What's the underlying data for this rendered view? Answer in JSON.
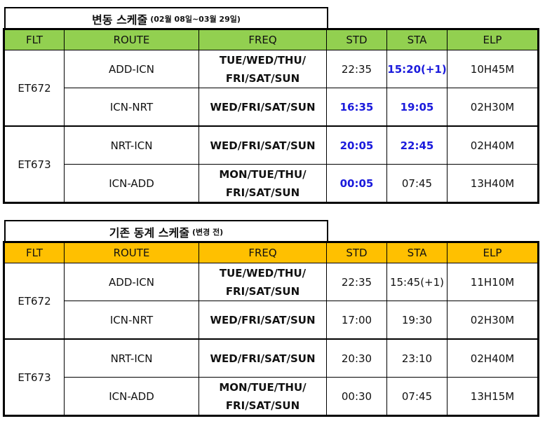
{
  "sections": [
    {
      "title": "변동 스케줄",
      "subtitle": "(02월 08일~03월 29일)",
      "header_color": "#92d050",
      "headers": [
        "FLT",
        "ROUTE",
        "FREQ",
        "STD",
        "STA",
        "ELP"
      ],
      "flights": [
        {
          "flt": "ET672",
          "rows": [
            {
              "route": "ADD-ICN",
              "freq": "TUE/WED/THU/\nFRI/SAT/SUN",
              "std": "22:35",
              "sta": "15:20(+1)",
              "elp": "10H45M",
              "std_changed": false,
              "sta_changed": true
            },
            {
              "route": "ICN-NRT",
              "freq": "WED/FRI/SAT/SUN",
              "std": "16:35",
              "sta": "19:05",
              "elp": "02H30M",
              "std_changed": true,
              "sta_changed": true
            }
          ]
        },
        {
          "flt": "ET673",
          "rows": [
            {
              "route": "NRT-ICN",
              "freq": "WED/FRI/SAT/SUN",
              "std": "20:05",
              "sta": "22:45",
              "elp": "02H40M",
              "std_changed": true,
              "sta_changed": true
            },
            {
              "route": "ICN-ADD",
              "freq": "MON/TUE/THU/\nFRI/SAT/SUN",
              "std": "00:05",
              "sta": "07:45",
              "elp": "13H40M",
              "std_changed": true,
              "sta_changed": false
            }
          ]
        }
      ]
    },
    {
      "title": "기존 동계 스케줄",
      "subtitle": "(변경 전)",
      "header_color": "#ffc000",
      "headers": [
        "FLT",
        "ROUTE",
        "FREQ",
        "STD",
        "STA",
        "ELP"
      ],
      "flights": [
        {
          "flt": "ET672",
          "rows": [
            {
              "route": "ADD-ICN",
              "freq": "TUE/WED/THU/\nFRI/SAT/SUN",
              "std": "22:35",
              "sta": "15:45(+1)",
              "elp": "11H10M",
              "std_changed": false,
              "sta_changed": false
            },
            {
              "route": "ICN-NRT",
              "freq": "WED/FRI/SAT/SUN",
              "std": "17:00",
              "sta": "19:30",
              "elp": "02H30M",
              "std_changed": false,
              "sta_changed": false
            }
          ]
        },
        {
          "flt": "ET673",
          "rows": [
            {
              "route": "NRT-ICN",
              "freq": "WED/FRI/SAT/SUN",
              "std": "20:30",
              "sta": "23:10",
              "elp": "02H40M",
              "std_changed": false,
              "sta_changed": false
            },
            {
              "route": "ICN-ADD",
              "freq": "MON/TUE/THU/\nFRI/SAT/SUN",
              "std": "00:30",
              "sta": "07:45",
              "elp": "13H15M",
              "std_changed": false,
              "sta_changed": false
            }
          ]
        }
      ]
    }
  ]
}
